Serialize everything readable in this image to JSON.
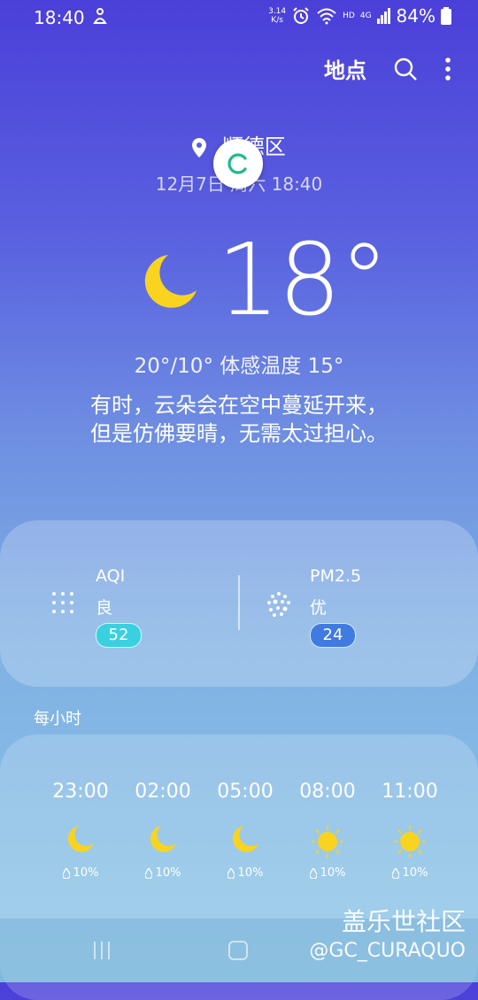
{
  "status_bar": {
    "time": "18:40",
    "speed_value": "3.14",
    "speed_unit": "K/s",
    "hd": "HD",
    "network": "4G",
    "battery": "84%"
  },
  "app_bar": {
    "locations_label": "地点"
  },
  "current": {
    "location": "顺德区",
    "datetime": "12月7日 周六 18:40",
    "temperature": "18°",
    "hi_lo_feels": "20°/10° 体感温度 15°",
    "description_line1": "有时，云朵会在空中蔓延开来，",
    "description_line2": "但是仿佛要晴，无需太过担心。",
    "icon": "moon-icon"
  },
  "air_quality": {
    "aqi_label": "AQI",
    "aqi_level": "良",
    "aqi_value": "52",
    "aqi_color": "#3ad0e0",
    "pm25_label": "PM2.5",
    "pm25_level": "优",
    "pm25_value": "24",
    "pm25_color": "#3f7be0"
  },
  "hourly": {
    "title": "每小时",
    "items": [
      {
        "time": "23:00",
        "icon": "moon-icon",
        "precip": "10%"
      },
      {
        "time": "02:00",
        "icon": "moon-icon",
        "precip": "10%"
      },
      {
        "time": "05:00",
        "icon": "moon-icon",
        "precip": "10%"
      },
      {
        "time": "08:00",
        "icon": "sun-icon",
        "precip": "10%"
      },
      {
        "time": "11:00",
        "icon": "sun-icon",
        "precip": "10%"
      }
    ]
  },
  "watermark": {
    "line1": "盖乐世社区",
    "line2": "@GC_CURAQUO"
  }
}
